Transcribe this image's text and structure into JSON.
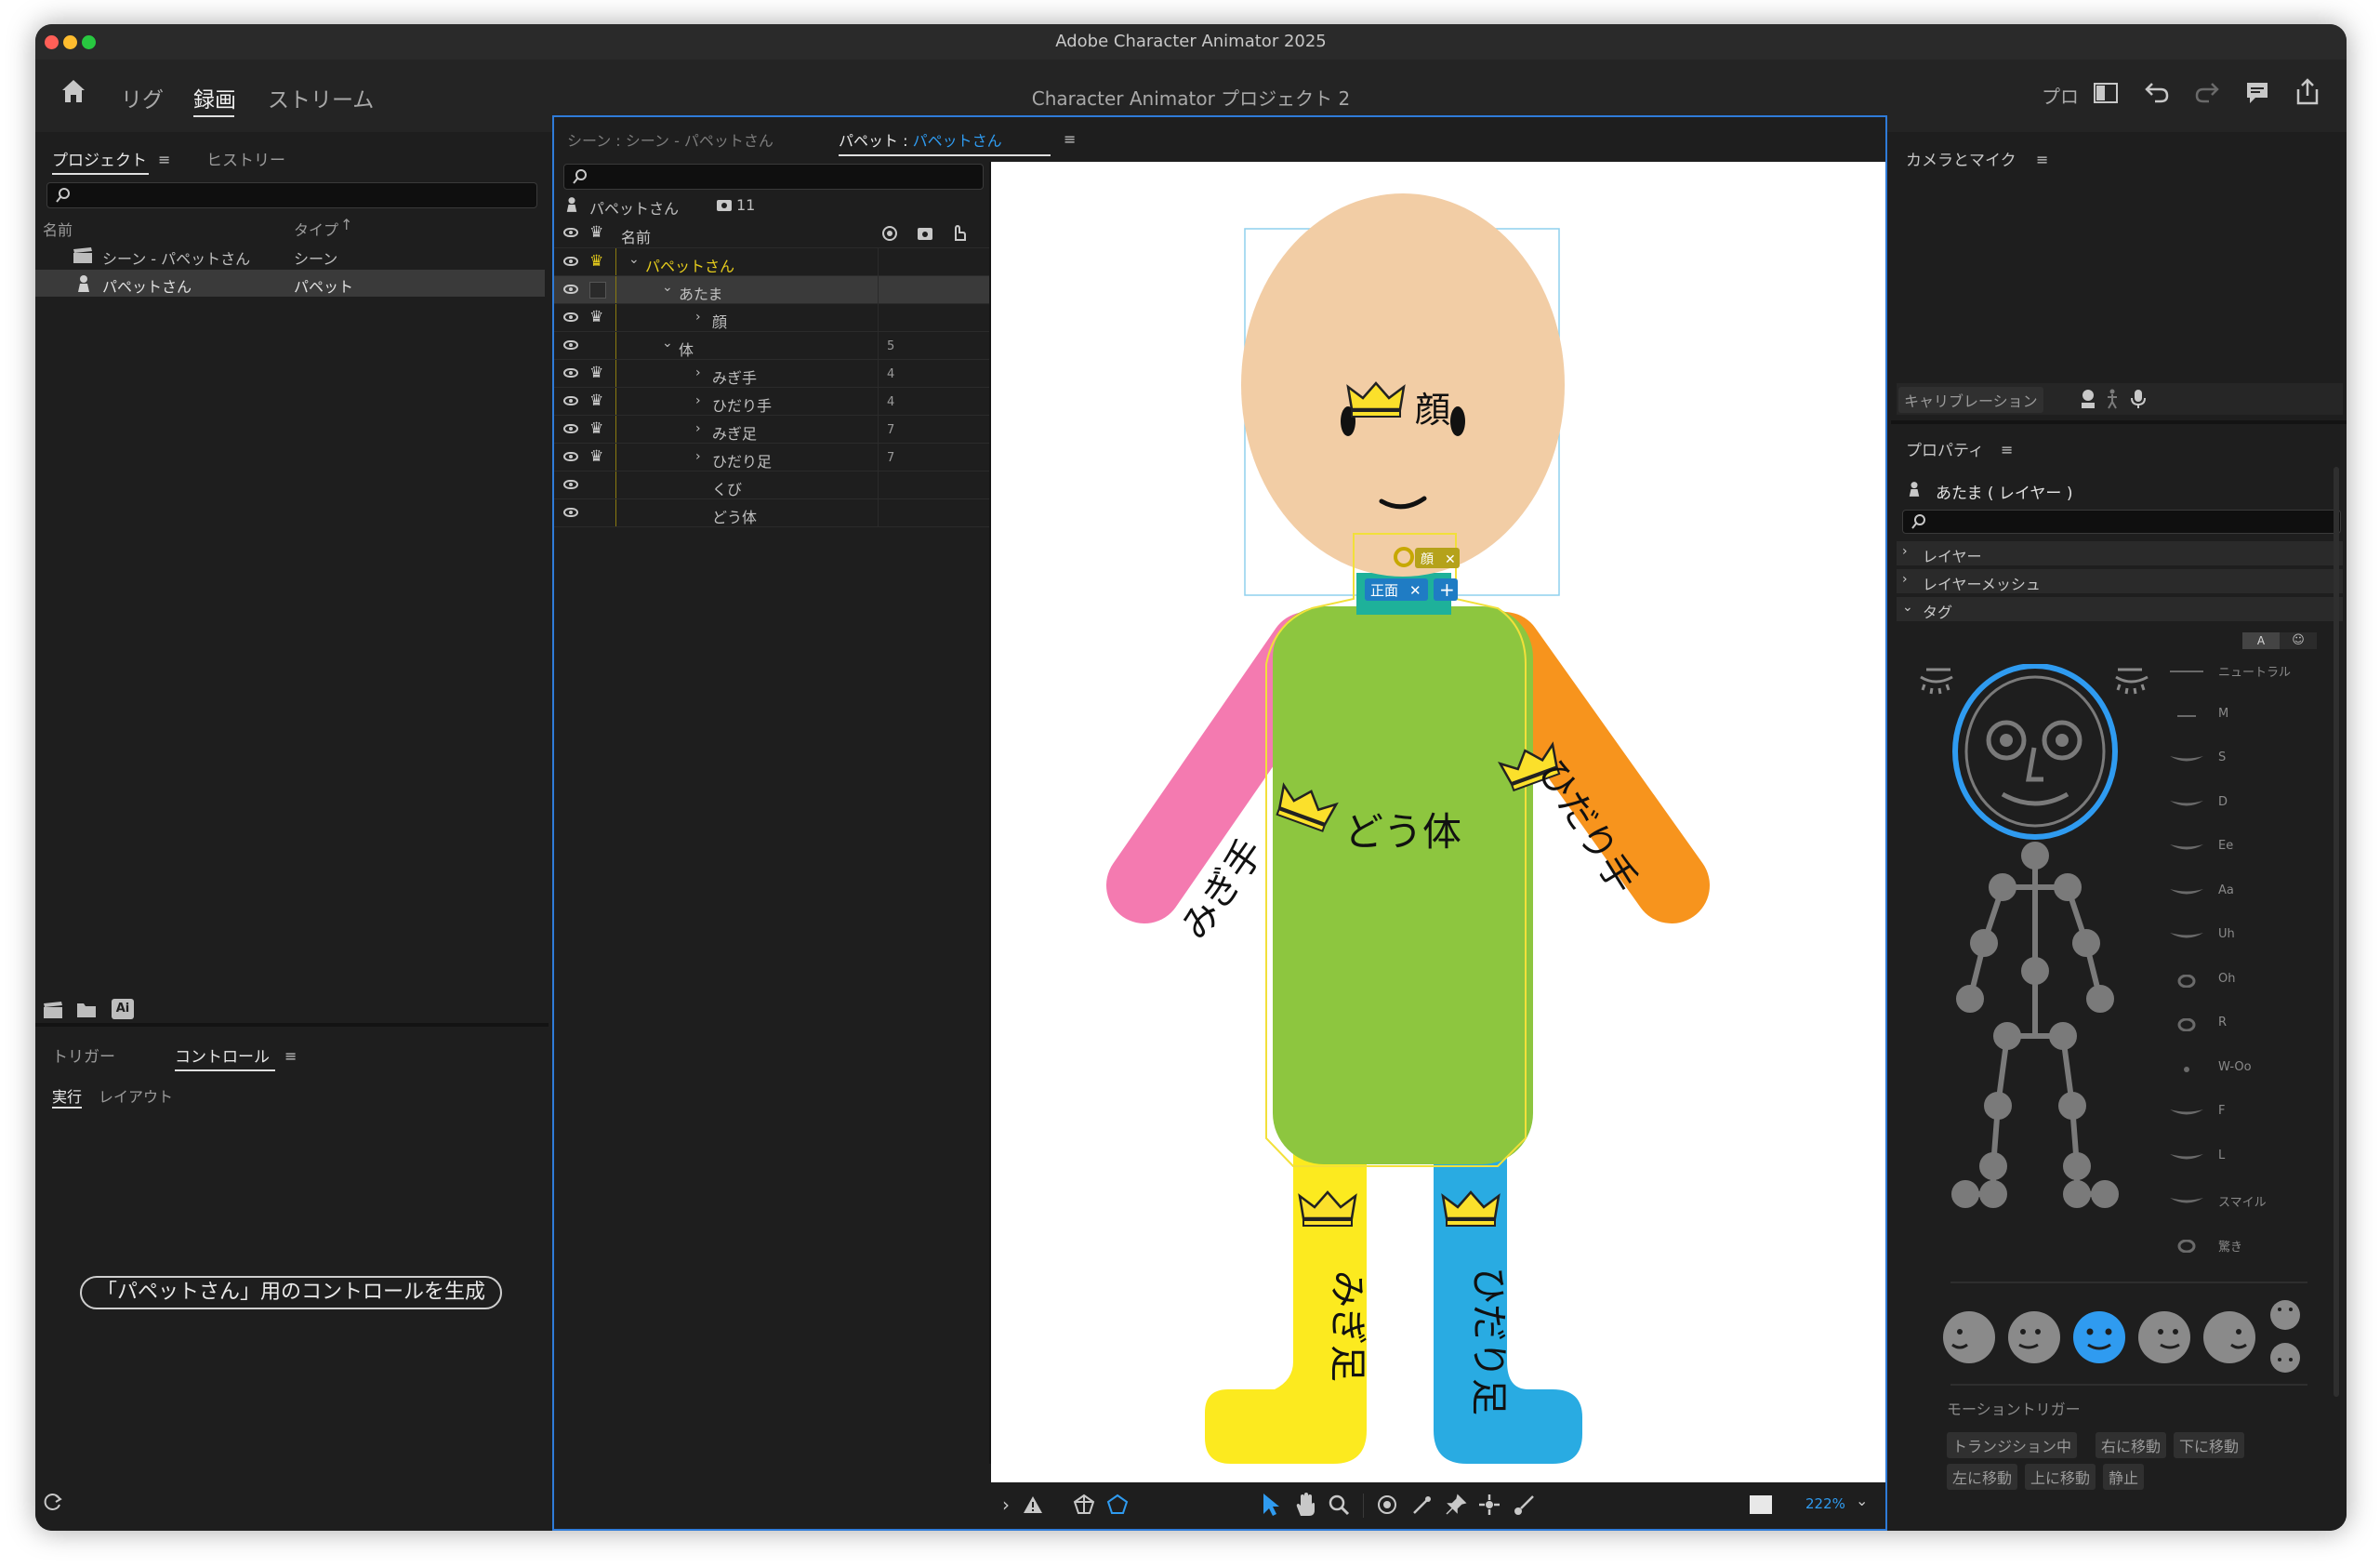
{
  "app": {
    "window_title": "Adobe Character Animator 2025",
    "project_title": "Character Animator プロジェクト 2"
  },
  "nav": {
    "rig": "リグ",
    "record": "録画",
    "stream": "ストリーム",
    "right_label": "プロ"
  },
  "project_panel": {
    "tab_project": "プロジェクト",
    "tab_history": "ヒストリー",
    "col_name": "名前",
    "col_type": "タイプ",
    "rows": [
      {
        "name": "シーン - パペットさん",
        "type": "シーン"
      },
      {
        "name": "パペットさん",
        "type": "パペット"
      }
    ]
  },
  "controls_panel": {
    "tab_trigger": "トリガー",
    "tab_controls": "コントロール",
    "sub_run": "実行",
    "sub_layout": "レイアウト",
    "generate_button": "「パペットさん」用のコントロールを生成"
  },
  "center": {
    "tab_scene_prefix": "シーン :",
    "tab_scene_name": "シーン - パペットさん",
    "tab_puppet_prefix": "パペット :",
    "tab_puppet_name": "パペットさん",
    "puppet_label": "パペットさん",
    "puppet_count": "11",
    "header_name": "名前",
    "layers": [
      {
        "name": "パペットさん",
        "indent": 0,
        "chev": "down",
        "crown": "yellow",
        "count": "",
        "hl": true
      },
      {
        "name": "あたま",
        "indent": 1,
        "chev": "down",
        "crown": "",
        "count": "",
        "selected": true
      },
      {
        "name": "顔",
        "indent": 2,
        "chev": "right",
        "crown": "white",
        "count": ""
      },
      {
        "name": "体",
        "indent": 1,
        "chev": "down",
        "crown": "",
        "count": "5"
      },
      {
        "name": "みぎ手",
        "indent": 2,
        "chev": "right",
        "crown": "white",
        "count": "4"
      },
      {
        "name": "ひだり手",
        "indent": 2,
        "chev": "right",
        "crown": "white",
        "count": "4"
      },
      {
        "name": "みぎ足",
        "indent": 2,
        "chev": "right",
        "crown": "white",
        "count": "7"
      },
      {
        "name": "ひだり足",
        "indent": 2,
        "chev": "right",
        "crown": "white",
        "count": "7"
      },
      {
        "name": "くび",
        "indent": 2,
        "chev": "",
        "crown": "",
        "count": ""
      },
      {
        "name": "どう体",
        "indent": 2,
        "chev": "",
        "crown": "",
        "count": ""
      }
    ]
  },
  "canvas": {
    "face_label": "顔",
    "body_label": "どう体",
    "right_arm_label": "みぎ手",
    "left_arm_label": "ひだり手",
    "right_leg_label": "みぎ足",
    "left_leg_label": "ひだり足",
    "tag_face": "顔",
    "tag_front": "正面",
    "zoom": "222%",
    "colors": {
      "face": "#f2cda5",
      "body": "#8dc63f",
      "right_arm": "#f47ab0",
      "left_arm": "#f7941d",
      "right_leg": "#fcea1f",
      "left_leg": "#29abe2"
    }
  },
  "camera_panel": {
    "title": "カメラとマイク",
    "calibration": "キャリブレーション"
  },
  "properties": {
    "title": "プロパティ",
    "selected": "あたま ( レイヤー )",
    "sections": [
      "レイヤー",
      "レイヤーメッシュ",
      "タグ"
    ],
    "visemes": [
      "ニュートラル",
      "M",
      "S",
      "D",
      "Ee",
      "Aa",
      "Uh",
      "Oh",
      "R",
      "W-Oo",
      "F",
      "L",
      "スマイル",
      "驚き"
    ],
    "motion_title": "モーショントリガー",
    "motion_tags": [
      "トランジション中",
      "右に移動",
      "下に移動",
      "左に移動",
      "上に移動",
      "静止"
    ]
  }
}
